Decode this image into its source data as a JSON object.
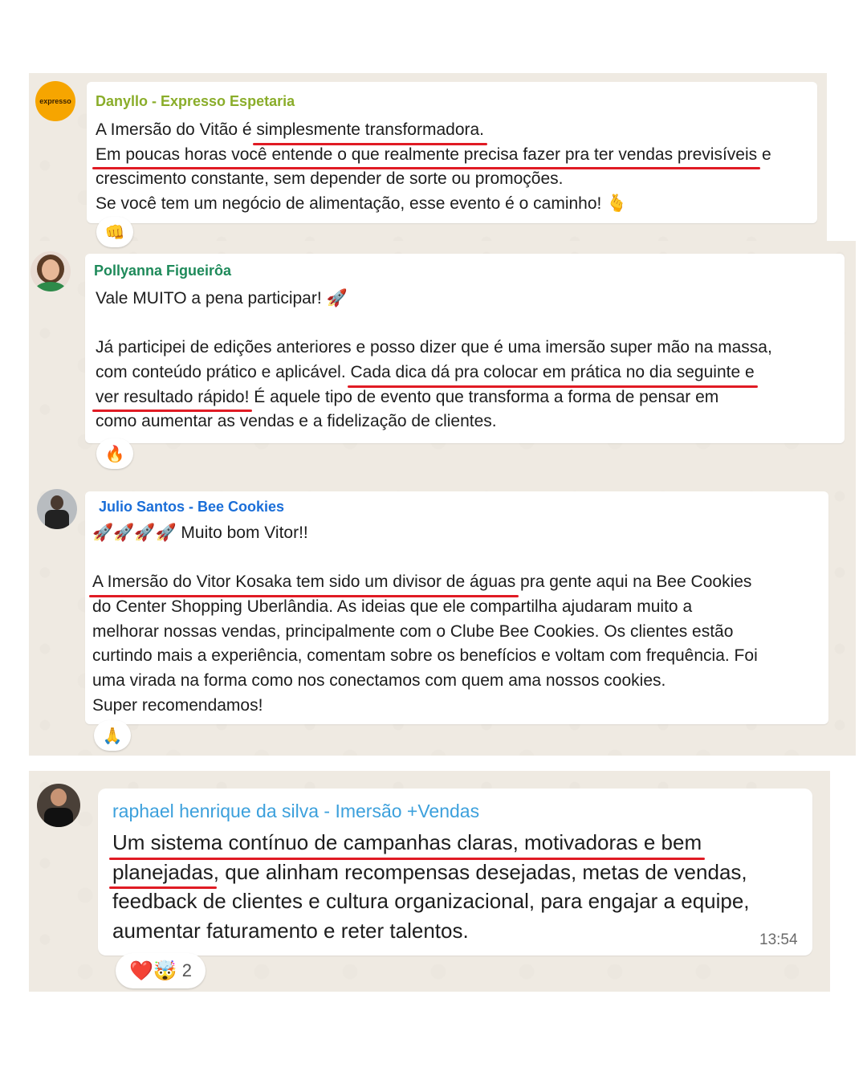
{
  "messages": [
    {
      "sender": "Danyllo - Expresso Espetaria",
      "avatar_text": "expresso",
      "line1_a": "A Imersão do Vitão é ",
      "line1_u": "simplesmente transformadora.",
      "line2_u": "Em poucas horas você entende o que realmente precisa fazer pra ter vendas previsíveis",
      "line2_b": " e",
      "line3": "crescimento constante, sem depender de sorte ou promoções.",
      "line4": "Se você tem um negócio de alimentação, esse evento é o caminho! 🫰",
      "reaction": "👊"
    },
    {
      "sender": "Pollyanna Figueirôa",
      "line1": "Vale MUITO a pena participar! 🚀",
      "line2": "Já participei de edições anteriores e posso dizer que é uma imersão super mão na massa,",
      "line3_a": "com conteúdo prático e aplicável. ",
      "line3_u": "Cada dica dá pra colocar em prática no dia seguinte e",
      "line4_u": "ver resultado rápido!",
      "line4_b": " É aquele tipo de evento que transforma a forma de pensar em",
      "line5": "como aumentar as vendas e a fidelização de clientes.",
      "reaction": "🔥"
    },
    {
      "sender": "Julio Santos - Bee Cookies",
      "line1": "🚀🚀🚀🚀 Muito bom Vitor!!",
      "line2_u": "A Imersão do Vitor Kosaka tem sido um divisor de águas",
      "line2_b": " pra gente aqui na Bee Cookies",
      "line3": "do Center Shopping Uberlândia. As ideias que ele compartilha ajudaram muito a",
      "line4": "melhorar nossas vendas, principalmente com o Clube Bee Cookies. Os clientes estão",
      "line5": "curtindo mais a experiência, comentam sobre os benefícios e voltam com frequência. Foi",
      "line6": "uma virada na forma como nos conectamos com quem ama nossos cookies.",
      "line7": "Super recomendamos!",
      "reaction": "🙏"
    },
    {
      "sender": "raphael henrique da silva - Imersão +Vendas",
      "line1_u": "Um sistema contínuo de campanhas claras, motivadoras e bem",
      "line2_u": "planejadas",
      "line2_b": ", que alinham recompensas desejadas, metas de vendas,",
      "line3": "feedback de clientes e cultura organizacional, para engajar a equipe,",
      "line4": "aumentar faturamento e reter talentos.",
      "time": "13:54",
      "reaction_emojis": "❤️🤯",
      "reaction_count": "2"
    }
  ],
  "colors": {
    "sender1": "#8aad2a",
    "sender2": "#1e8a5a",
    "sender3": "#1a6ed8",
    "sender4": "#3ca0dc",
    "underline": "#e01b24",
    "chat_bg": "#efeae2"
  }
}
